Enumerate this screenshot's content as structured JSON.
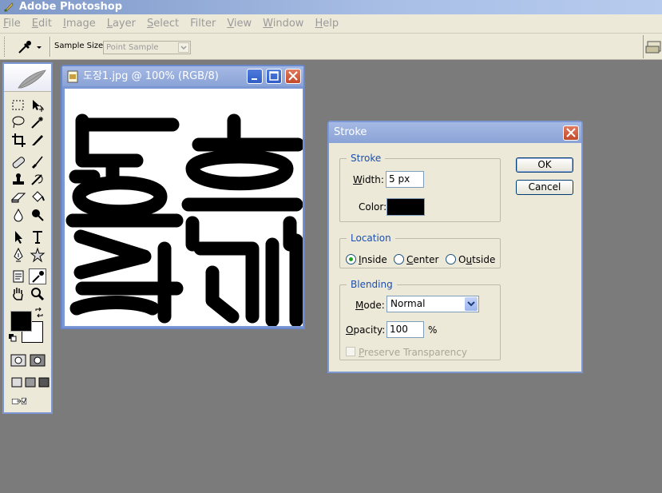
{
  "app": {
    "title": "Adobe Photoshop"
  },
  "menu": [
    {
      "pre": "",
      "u": "F",
      "post": "ile"
    },
    {
      "pre": "",
      "u": "E",
      "post": "dit"
    },
    {
      "pre": "",
      "u": "I",
      "post": "mage"
    },
    {
      "pre": "",
      "u": "L",
      "post": "ayer"
    },
    {
      "pre": "",
      "u": "S",
      "post": "elect"
    },
    {
      "pre": "",
      "u": "F",
      "post": "ilter"
    },
    {
      "pre": "",
      "u": "V",
      "post": "iew"
    },
    {
      "pre": "",
      "u": "W",
      "post": "indow"
    },
    {
      "pre": "",
      "u": "H",
      "post": "elp"
    }
  ],
  "options": {
    "sample_size_label": "Sample Size:",
    "sample_size_value": "Point Sample"
  },
  "document": {
    "title": "도장1.jpg @ 100% (RGB/8)"
  },
  "dialog": {
    "title": "Stroke",
    "stroke_group": "Stroke",
    "width_label_pre": "",
    "width_label_u": "W",
    "width_label_post": "idth:",
    "width_value": "5 px",
    "color_label": "Color:",
    "color_value": "#000000",
    "location_group": "Location",
    "inside_pre": "",
    "inside_u": "I",
    "inside_post": "nside",
    "center_pre": "",
    "center_u": "C",
    "center_post": "enter",
    "outside_pre": "O",
    "outside_u": "u",
    "outside_post": "tside",
    "selected_location": "Inside",
    "blending_group": "Blending",
    "mode_label_pre": "",
    "mode_label_u": "M",
    "mode_label_post": "ode:",
    "mode_value": "Normal",
    "opacity_label_pre": "",
    "opacity_label_u": "O",
    "opacity_label_post": "pacity:",
    "opacity_value": "100",
    "opacity_unit": "%",
    "preserve_pre": "",
    "preserve_u": "P",
    "preserve_post": "reserve Transparency",
    "ok": "OK",
    "cancel": "Cancel"
  },
  "colors": {
    "foreground": "#000000",
    "background": "#ffffff",
    "accent": "#7b98d4",
    "dialog_bg": "#ece9d8"
  }
}
